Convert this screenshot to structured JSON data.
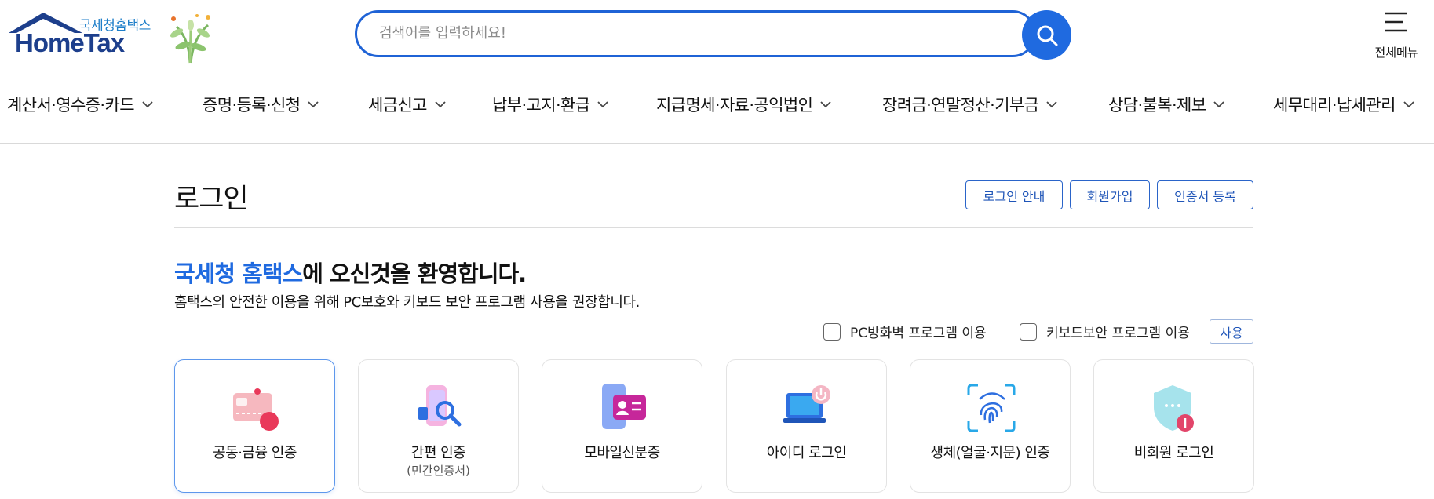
{
  "header": {
    "logo_small": "국세청홈택스",
    "logo_main": "HomeTax",
    "search_placeholder": "검색어를 입력하세요!",
    "all_menu_label": "전체메뉴"
  },
  "nav": {
    "items": [
      "계산서·영수증·카드",
      "증명·등록·신청",
      "세금신고",
      "납부·고지·환급",
      "지급명세·자료·공익법인",
      "장려금·연말정산·기부금",
      "상담·불복·제보",
      "세무대리·납세관리"
    ]
  },
  "login": {
    "title": "로그인",
    "buttons": [
      "로그인 안내",
      "회원가입",
      "인증서 등록"
    ],
    "welcome_accent": "국세청 홈택스",
    "welcome_rest": "에 오신것을 환영합니다.",
    "description": "홈택스의 안전한 이용을 위해 PC보호와 키보드 보안 프로그램 사용을 권장합니다.",
    "options": [
      {
        "label": "PC방화벽 프로그램 이용",
        "checked": false
      },
      {
        "label": "키보드보안 프로그램 이용",
        "checked": false
      }
    ],
    "use_label": "사용",
    "methods": [
      {
        "label": "공동·금융 인증",
        "sub": "",
        "icon": "certificate-card-icon",
        "selected": true
      },
      {
        "label": "간편 인증",
        "sub": "(민간인증서)",
        "icon": "simple-auth-icon",
        "selected": false
      },
      {
        "label": "모바일신분증",
        "sub": "",
        "icon": "mobile-id-icon",
        "selected": false
      },
      {
        "label": "아이디 로그인",
        "sub": "",
        "icon": "id-login-icon",
        "selected": false
      },
      {
        "label": "생체(얼굴·지문) 인증",
        "sub": "",
        "icon": "fingerprint-icon",
        "selected": false
      },
      {
        "label": "비회원 로그인",
        "sub": "",
        "icon": "shield-key-icon",
        "selected": false
      }
    ]
  },
  "colors": {
    "accent": "#1f6ae0",
    "brand_navy": "#1d3f8c",
    "button_border": "#2a64c9"
  }
}
